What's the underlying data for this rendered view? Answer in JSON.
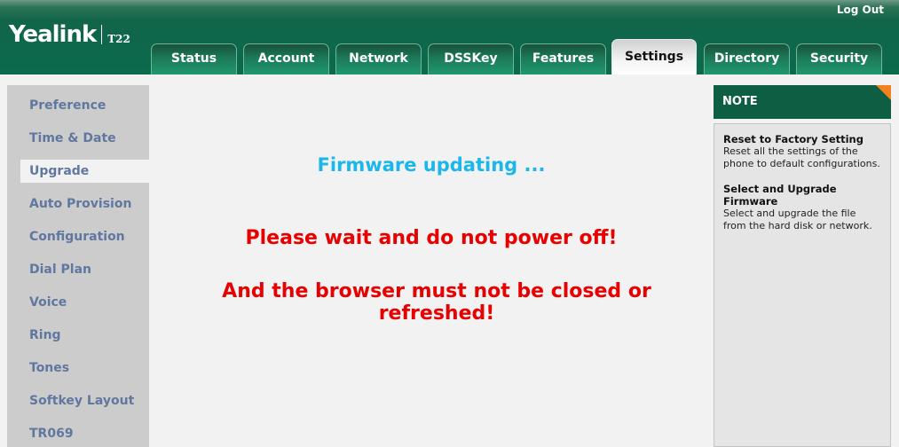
{
  "header": {
    "brand": "Yealink",
    "model": "T22",
    "logout_label": "Log Out"
  },
  "tabs": [
    {
      "label": "Status",
      "active": false
    },
    {
      "label": "Account",
      "active": false
    },
    {
      "label": "Network",
      "active": false
    },
    {
      "label": "DSSKey",
      "active": false
    },
    {
      "label": "Features",
      "active": false
    },
    {
      "label": "Settings",
      "active": true
    },
    {
      "label": "Directory",
      "active": false
    },
    {
      "label": "Security",
      "active": false
    }
  ],
  "sidebar": {
    "items": [
      {
        "label": "Preference"
      },
      {
        "label": "Time & Date"
      },
      {
        "label": "Upgrade",
        "active": true
      },
      {
        "label": "Auto Provision"
      },
      {
        "label": "Configuration"
      },
      {
        "label": "Dial Plan"
      },
      {
        "label": "Voice"
      },
      {
        "label": "Ring"
      },
      {
        "label": "Tones"
      },
      {
        "label": "Softkey Layout"
      },
      {
        "label": "TR069"
      }
    ]
  },
  "main": {
    "status": "Firmware updating ...",
    "warning_1": "Please wait and do not power off!",
    "warning_2": "And the browser must not be closed or refreshed!"
  },
  "note": {
    "title": "NOTE",
    "items": [
      {
        "title": "Reset to Factory Setting",
        "text": "Reset all the settings of the phone to default configurations."
      },
      {
        "title": "Select and Upgrade Firmware",
        "text": "Select and upgrade the file from the hard disk or network."
      }
    ]
  },
  "colors": {
    "header_green": "#0b6a4d",
    "status_blue": "#1bb7ea",
    "warning_red": "#e80000",
    "sidebar_text": "#6077a0",
    "note_accent": "#f2821f"
  }
}
